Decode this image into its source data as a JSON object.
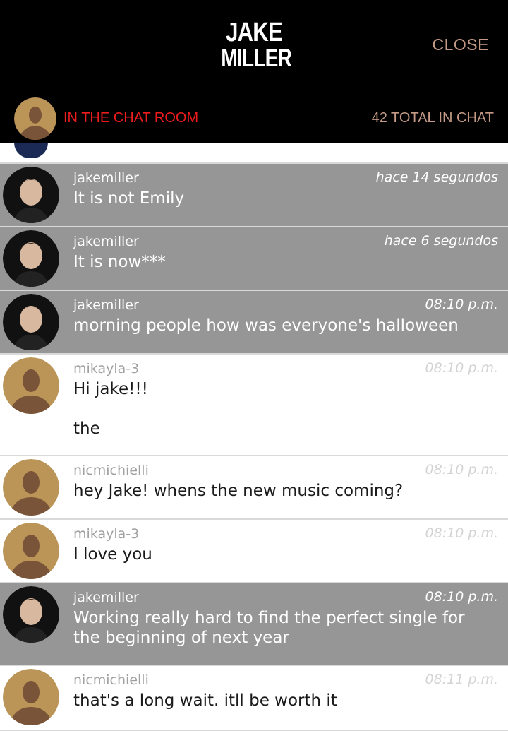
{
  "header": {
    "logo_line1": "JAKE",
    "logo_line2": "MILLER",
    "close_label": "CLOSE",
    "room_label": "IN THE CHAT ROOM",
    "total_label": "42 TOTAL IN CHAT"
  },
  "colors": {
    "header_bg": "#000000",
    "accent_red": "#ee1c1c",
    "accent_tan": "#c49a86",
    "host_message_bg": "#969696",
    "fan_message_bg": "#ffffff",
    "avatar_placeholder": "#bb9558"
  },
  "messages": [
    {
      "username": "jakemiller",
      "time": "hace 14 segundos",
      "text": "It is not Emily",
      "text2": "",
      "host": true
    },
    {
      "username": "jakemiller",
      "time": "hace 6 segundos",
      "text": "It is now***",
      "text2": "",
      "host": true
    },
    {
      "username": "jakemiller",
      "time": "08:10 p.m.",
      "text": "morning people how was everyone's halloween",
      "text2": "",
      "host": true
    },
    {
      "username": "mikayla-3",
      "time": "08:10 p.m.",
      "text": "Hi jake!!!",
      "text2": "the",
      "host": false
    },
    {
      "username": "nicmichielli",
      "time": "08:10 p.m.",
      "text": "hey Jake! whens the new music coming?",
      "text2": "",
      "host": false
    },
    {
      "username": "mikayla-3",
      "time": "08:10 p.m.",
      "text": "I love you",
      "text2": "",
      "host": false
    },
    {
      "username": "jakemiller",
      "time": "08:10 p.m.",
      "text": "Working really hard to find the perfect single for the beginning of next year",
      "text2": "",
      "host": true
    },
    {
      "username": "nicmichielli",
      "time": "08:11 p.m.",
      "text": "that's a long wait. itll be worth it",
      "text2": "",
      "host": false
    }
  ]
}
